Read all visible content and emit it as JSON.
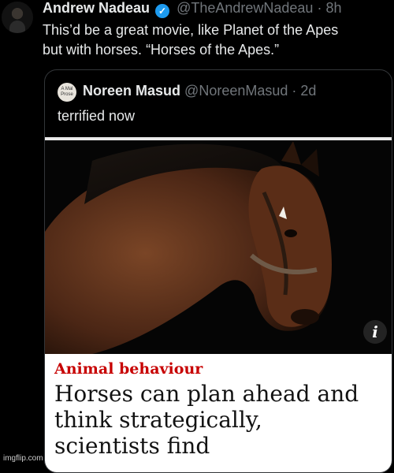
{
  "tweet": {
    "author_name": "Andrew Nadeau",
    "handle": "@TheAndrewNadeau",
    "time": "· 8h",
    "text_line1": "This’d be a great movie, like Planet of the Apes",
    "text_line2": "but with horses. “Horses of the Apes.”"
  },
  "quote": {
    "avatar_text": "A Mal Prose",
    "author_name": "Noreen Masud",
    "handle": "@NoreenMasud",
    "time": "· 2d",
    "text": "terrified now"
  },
  "article": {
    "kicker": "Animal behaviour",
    "headline_line1": "Horses can plan ahead and",
    "headline_line2": "think strategically,",
    "headline_line3": "scientists find",
    "info_icon_label": "i"
  },
  "watermark": "imgflip.com",
  "colors": {
    "verified": "#1d9bf0",
    "kicker": "#c70000",
    "muted": "#71767b"
  }
}
